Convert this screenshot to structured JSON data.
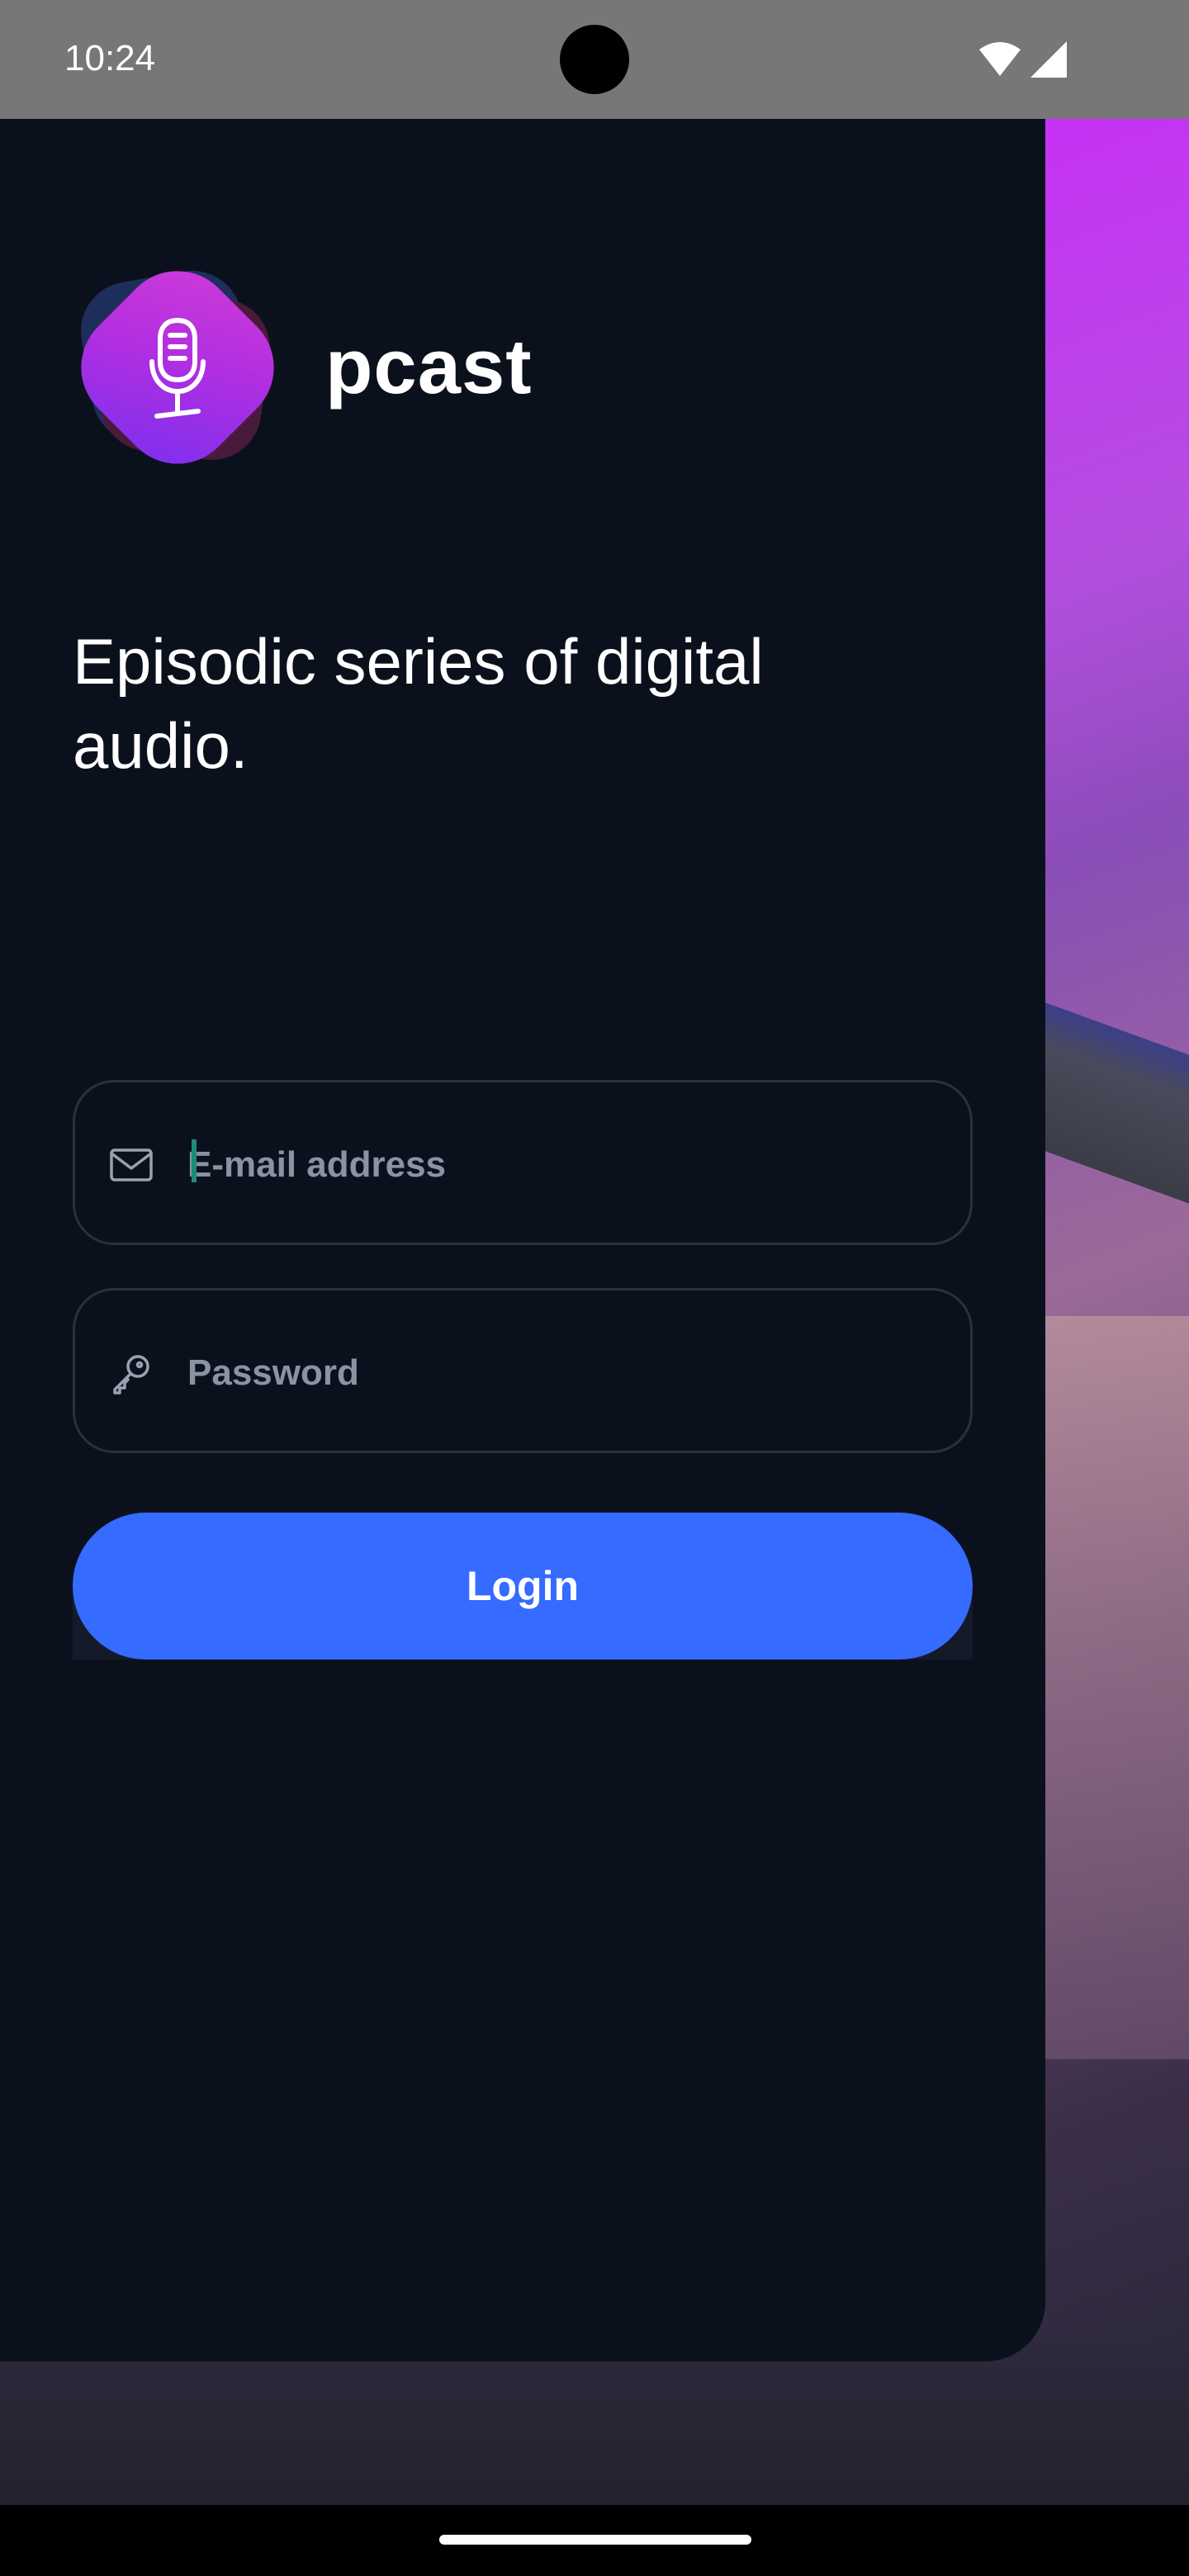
{
  "status_bar": {
    "time": "10:24",
    "icons": [
      "wifi-icon",
      "signal-icon"
    ]
  },
  "app": {
    "brand": "pcast",
    "logo_icon": "microphone-icon",
    "tagline": "Episodic series of digital audio."
  },
  "form": {
    "email": {
      "placeholder": "E-mail address",
      "value": "",
      "icon": "mail-icon"
    },
    "password": {
      "placeholder": "Password",
      "value": "",
      "icon": "key-icon"
    },
    "login_label": "Login"
  },
  "colors": {
    "panel_bg": "#0b111c",
    "accent": "#356bff",
    "logo_gradient": [
      "#d03bd8",
      "#7a2ff0"
    ],
    "caret": "#1c8c7a"
  }
}
